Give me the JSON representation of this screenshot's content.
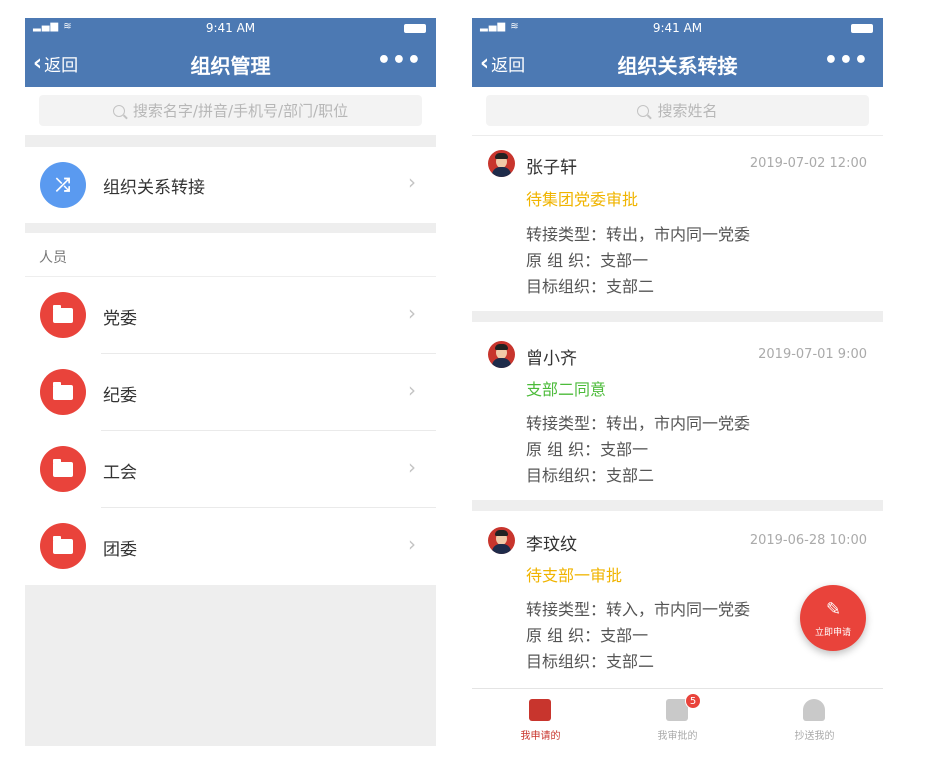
{
  "status_bar": {
    "time": "9:41 AM",
    "signal": "▂▄▆ ≋"
  },
  "left": {
    "nav": {
      "back_label": "返回",
      "title": "组织管理",
      "more": "•••"
    },
    "search_placeholder": "搜索名字/拼音/手机号/部门/职位",
    "transfer_item": {
      "label": "组织关系转接",
      "icon": "shuffle-icon"
    },
    "section_title": "人员",
    "folders": [
      {
        "label": "党委",
        "icon": "folder-icon"
      },
      {
        "label": "纪委",
        "icon": "folder-icon"
      },
      {
        "label": "工会",
        "icon": "folder-icon"
      },
      {
        "label": "团委",
        "icon": "folder-icon"
      }
    ]
  },
  "right": {
    "nav": {
      "back_label": "返回",
      "title": "组织关系转接",
      "more": "•••"
    },
    "search_placeholder": "搜索姓名",
    "records": [
      {
        "name": "张子轩",
        "date": "2019-07-02 12:00",
        "status": "待集团党委审批",
        "status_color": "#f0b400",
        "type_line": "转接类型：转出，市内同一党委",
        "from_line": "原 组 织：支部一",
        "to_line": "目标组织：支部二"
      },
      {
        "name": "曾小齐",
        "date": "2019-07-01 9:00",
        "status": "支部二同意",
        "status_color": "#4cbb3a",
        "type_line": "转接类型：转出，市内同一党委",
        "from_line": "原 组 织：支部一",
        "to_line": "目标组织：支部二"
      },
      {
        "name": "李玟纹",
        "date": "2019-06-28 10:00",
        "status": "待支部一审批",
        "status_color": "#f0b400",
        "type_line": "转接类型：转入，市内同一党委",
        "from_line": "原 组 织：支部一",
        "to_line": "目标组织：支部二"
      }
    ],
    "fab_label": "立即申请",
    "tabs": [
      {
        "label": "我申请的",
        "active": true,
        "color": "#c8352d"
      },
      {
        "label": "我审批的",
        "active": false,
        "badge": "5",
        "color": "#b5b5b5"
      },
      {
        "label": "抄送我的",
        "active": false,
        "color": "#b5b5b5"
      }
    ]
  }
}
